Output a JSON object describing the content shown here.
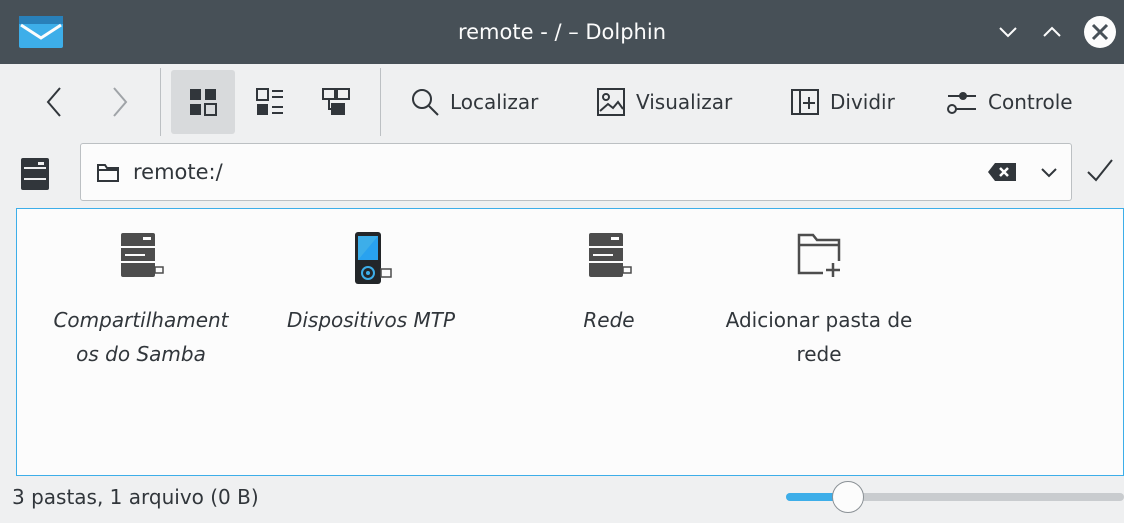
{
  "window": {
    "title": "remote - / – Dolphin",
    "controls": [
      "minimize-icon",
      "maximize-icon",
      "close-icon"
    ]
  },
  "toolbar": {
    "nav": [
      "back-icon",
      "forward-icon"
    ],
    "view_modes": [
      "icons-view-icon",
      "compact-view-icon",
      "details-view-icon"
    ],
    "actions": [
      {
        "label": "Localizar",
        "icon": "search-icon"
      },
      {
        "label": "Visualizar",
        "icon": "preview-icon"
      },
      {
        "label": "Dividir",
        "icon": "split-icon"
      },
      {
        "label": "Controle",
        "icon": "control-icon"
      }
    ]
  },
  "location": {
    "path": "remote:/"
  },
  "items": [
    {
      "label": "Compartilhament os do Samba",
      "line1": "Compartilhament",
      "line2": "os do Samba",
      "icon": "network-server-icon",
      "italic": true
    },
    {
      "label": "Dispositivos MTP",
      "line1": "Dispositivos MTP",
      "line2": "",
      "icon": "mtp-device-icon",
      "italic": true
    },
    {
      "label": "Rede",
      "line1": "Rede",
      "line2": "",
      "icon": "network-server-icon",
      "italic": true
    },
    {
      "label": "Adicionar pasta de rede",
      "line1": "Adicionar pasta de",
      "line2": "rede",
      "icon": "folder-add-icon",
      "italic": false
    }
  ],
  "status": {
    "text": "3 pastas, 1 arquivo (0 B)",
    "zoom_fraction": 0.15
  },
  "colors": {
    "titlebar": "#475057",
    "accent": "#3daee9",
    "background": "#eff0f1",
    "view_background": "#fcfcfc"
  }
}
